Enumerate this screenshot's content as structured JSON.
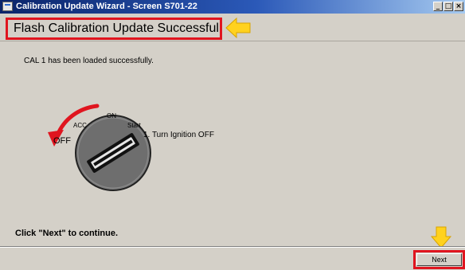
{
  "window": {
    "title": "Calibration Update Wizard - Screen S701-22",
    "buttons": {
      "minimize": "_",
      "maximize": "□",
      "close": "×"
    }
  },
  "header": {
    "title": "Flash Calibration Update Successful"
  },
  "main": {
    "message": "CAL 1 has been loaded successfully.",
    "ignition": {
      "labels": {
        "on": "ON",
        "acc": "ACC",
        "start": "Start",
        "off": "OFF"
      },
      "instruction": "1. Turn Ignition OFF"
    },
    "footer_hint": "Click \"Next\" to continue."
  },
  "footer": {
    "next_label": "Next"
  },
  "icons": {
    "app": "window-app-icon",
    "callout_heading": "yellow-left-arrow-icon",
    "callout_next": "yellow-down-arrow-icon",
    "rotation": "red-curved-arrow-icon",
    "key": "ignition-key-icon"
  },
  "colors": {
    "highlight": "#e0151f",
    "callout": "#ffd21f",
    "titlebar": "#0a246a",
    "dialog_bg": "#d4d0c8"
  }
}
